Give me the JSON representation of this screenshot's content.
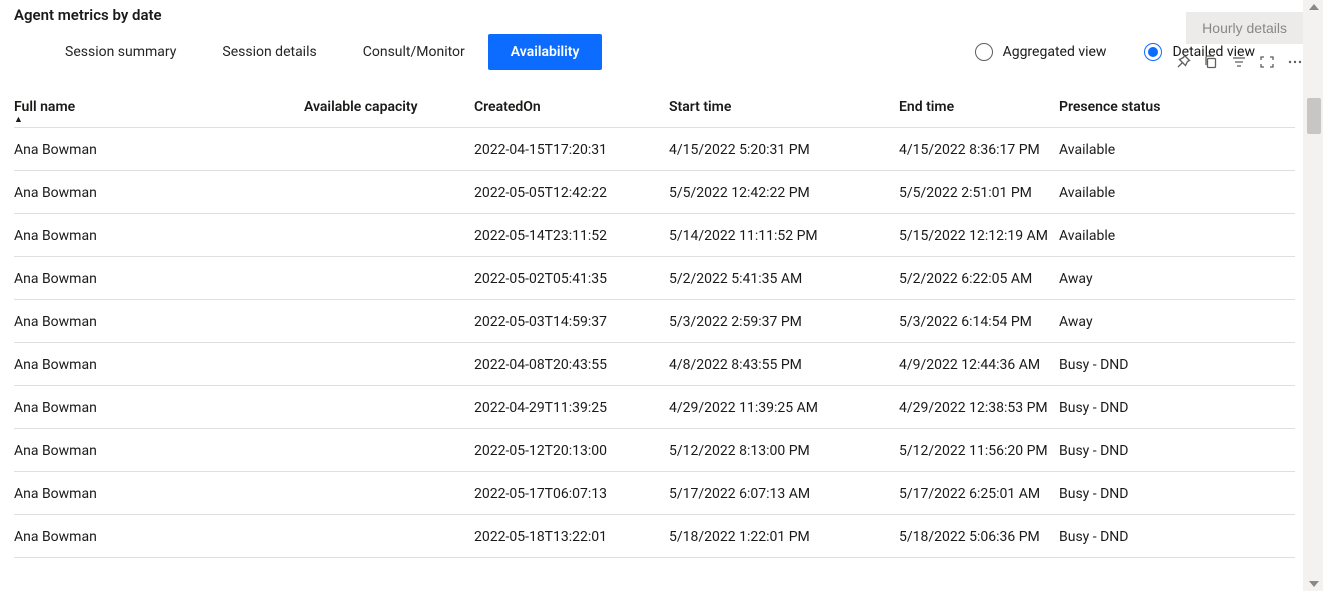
{
  "title": "Agent metrics by date",
  "tabs": [
    {
      "label": "Session summary",
      "active": false
    },
    {
      "label": "Session details",
      "active": false
    },
    {
      "label": "Consult/Monitor",
      "active": false
    },
    {
      "label": "Availability",
      "active": true
    }
  ],
  "views": {
    "aggregated_label": "Aggregated view",
    "detailed_label": "Detailed view",
    "selected": "detailed"
  },
  "hourly_button": "Hourly details",
  "toolbar_icons": {
    "pin": "pin-icon",
    "copy": "copy-icon",
    "filter": "filter-icon",
    "focus": "focus-mode-icon",
    "more": "more-options-icon"
  },
  "columns": [
    {
      "key": "full_name",
      "label": "Full name",
      "sorted": "asc"
    },
    {
      "key": "available_capacity",
      "label": "Available capacity"
    },
    {
      "key": "created_on",
      "label": "CreatedOn"
    },
    {
      "key": "start_time",
      "label": "Start time"
    },
    {
      "key": "end_time",
      "label": "End time"
    },
    {
      "key": "presence_status",
      "label": "Presence status"
    }
  ],
  "rows": [
    {
      "full_name": "Ana Bowman",
      "available_capacity": "",
      "created_on": "2022-04-15T17:20:31",
      "start_time": "4/15/2022 5:20:31 PM",
      "end_time": "4/15/2022 8:36:17 PM",
      "presence_status": "Available"
    },
    {
      "full_name": "Ana Bowman",
      "available_capacity": "",
      "created_on": "2022-05-05T12:42:22",
      "start_time": "5/5/2022 12:42:22 PM",
      "end_time": "5/5/2022 2:51:01 PM",
      "presence_status": "Available"
    },
    {
      "full_name": "Ana Bowman",
      "available_capacity": "",
      "created_on": "2022-05-14T23:11:52",
      "start_time": "5/14/2022 11:11:52 PM",
      "end_time": "5/15/2022 12:12:19 AM",
      "presence_status": "Available"
    },
    {
      "full_name": "Ana Bowman",
      "available_capacity": "",
      "created_on": "2022-05-02T05:41:35",
      "start_time": "5/2/2022 5:41:35 AM",
      "end_time": "5/2/2022 6:22:05 AM",
      "presence_status": "Away"
    },
    {
      "full_name": "Ana Bowman",
      "available_capacity": "",
      "created_on": "2022-05-03T14:59:37",
      "start_time": "5/3/2022 2:59:37 PM",
      "end_time": "5/3/2022 6:14:54 PM",
      "presence_status": "Away"
    },
    {
      "full_name": "Ana Bowman",
      "available_capacity": "",
      "created_on": "2022-04-08T20:43:55",
      "start_time": "4/8/2022 8:43:55 PM",
      "end_time": "4/9/2022 12:44:36 AM",
      "presence_status": "Busy - DND"
    },
    {
      "full_name": "Ana Bowman",
      "available_capacity": "",
      "created_on": "2022-04-29T11:39:25",
      "start_time": "4/29/2022 11:39:25 AM",
      "end_time": "4/29/2022 12:38:53 PM",
      "presence_status": "Busy - DND"
    },
    {
      "full_name": "Ana Bowman",
      "available_capacity": "",
      "created_on": "2022-05-12T20:13:00",
      "start_time": "5/12/2022 8:13:00 PM",
      "end_time": "5/12/2022 11:56:20 PM",
      "presence_status": "Busy - DND"
    },
    {
      "full_name": "Ana Bowman",
      "available_capacity": "",
      "created_on": "2022-05-17T06:07:13",
      "start_time": "5/17/2022 6:07:13 AM",
      "end_time": "5/17/2022 6:25:01 AM",
      "presence_status": "Busy - DND"
    },
    {
      "full_name": "Ana Bowman",
      "available_capacity": "",
      "created_on": "2022-05-18T13:22:01",
      "start_time": "5/18/2022 1:22:01 PM",
      "end_time": "5/18/2022 5:06:36 PM",
      "presence_status": "Busy - DND"
    }
  ]
}
